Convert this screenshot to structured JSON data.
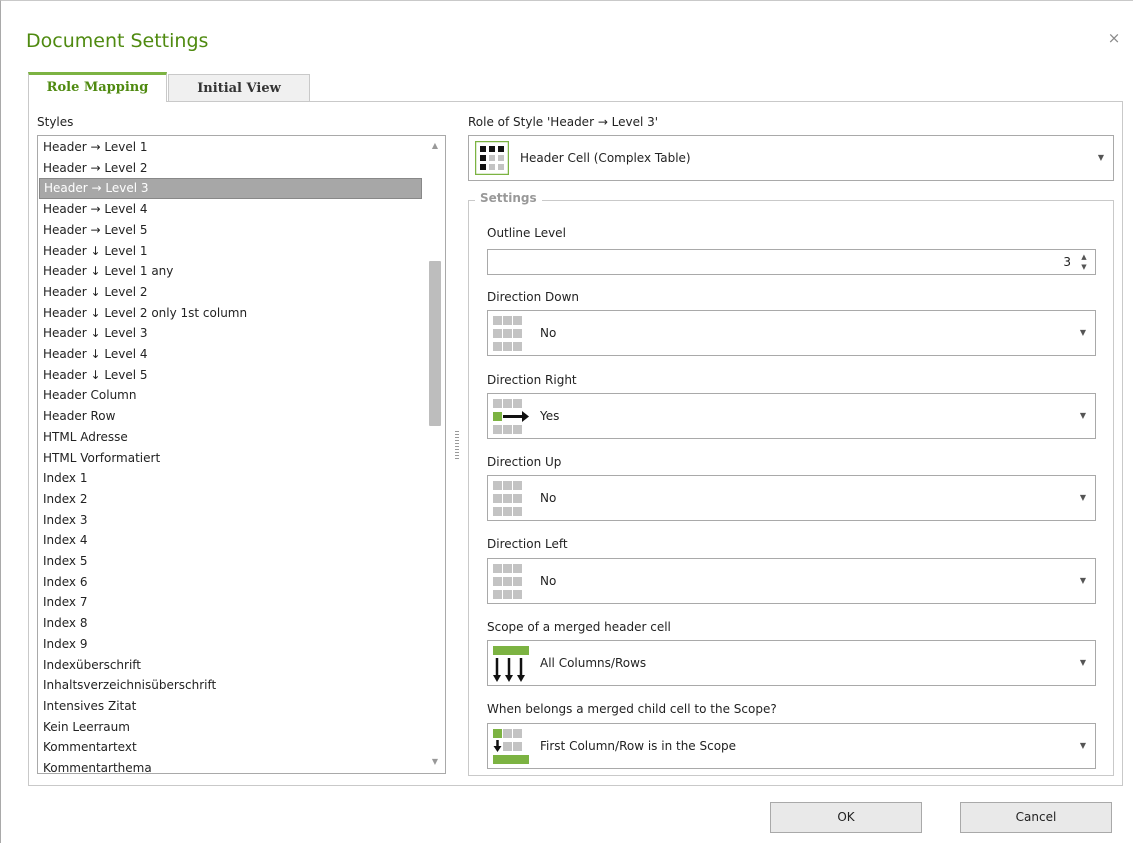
{
  "dialog": {
    "title": "Document Settings",
    "close_glyph": "×"
  },
  "tabs": [
    {
      "label": "Role Mapping"
    },
    {
      "label": "Initial View"
    }
  ],
  "styles": {
    "label": "Styles",
    "selected_index": 2,
    "items": [
      "Header → Level 1",
      "Header → Level 2",
      "Header → Level 3",
      "Header → Level 4",
      "Header → Level 5",
      "Header ↓ Level 1",
      "Header ↓ Level 1 any",
      "Header ↓ Level 2",
      "Header ↓ Level 2 only 1st column",
      "Header ↓ Level 3",
      "Header ↓ Level 4",
      "Header ↓ Level 5",
      "Header Column",
      "Header Row",
      "HTML Adresse",
      "HTML Vorformatiert",
      "Index 1",
      "Index 2",
      "Index 3",
      "Index 4",
      "Index 5",
      "Index 6",
      "Index 7",
      "Index 8",
      "Index 9",
      "Indexüberschrift",
      "Inhaltsverzeichnisüberschrift",
      "Intensives Zitat",
      "Kein Leerraum",
      "Kommentartext",
      "Kommentarthema"
    ]
  },
  "role": {
    "label": "Role of Style 'Header → Level 3'",
    "value": "Header Cell (Complex Table)"
  },
  "settings": {
    "legend": "Settings",
    "outline_level": {
      "label": "Outline Level",
      "value": "3"
    },
    "direction_down": {
      "label": "Direction Down",
      "value": "No"
    },
    "direction_right": {
      "label": "Direction Right",
      "value": "Yes"
    },
    "direction_up": {
      "label": "Direction Up",
      "value": "No"
    },
    "direction_left": {
      "label": "Direction Left",
      "value": "No"
    },
    "scope": {
      "label": "Scope of a merged header cell",
      "value": "All Columns/Rows"
    },
    "child_scope": {
      "label": "When belongs a merged child cell to the Scope?",
      "value": "First Column/Row is in the Scope"
    }
  },
  "buttons": {
    "ok": "OK",
    "cancel": "Cancel"
  },
  "colors": {
    "accent": "#7cb342",
    "title": "#4f8a10",
    "selection": "#a7a7a7",
    "grid_gray": "#c3c3c3"
  }
}
